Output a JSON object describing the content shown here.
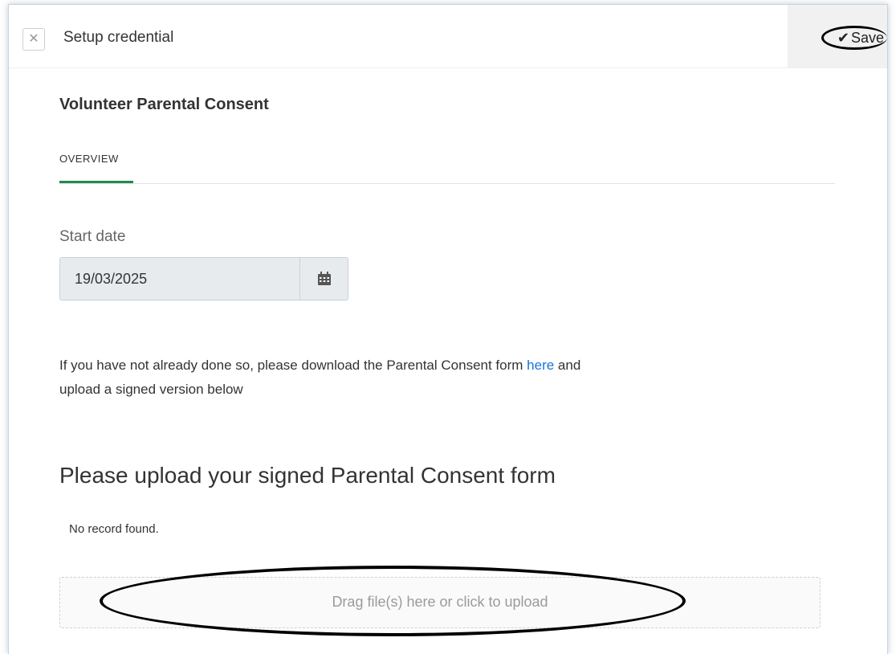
{
  "header": {
    "title": "Setup credential",
    "close_icon": "close-icon",
    "save_label": "Save",
    "save_icon": "check-icon"
  },
  "main": {
    "heading": "Volunteer Parental Consent",
    "tabs": [
      {
        "label": "OVERVIEW",
        "active": true
      }
    ],
    "start_date": {
      "label": "Start date",
      "value": "19/03/2025",
      "icon": "calendar-icon"
    },
    "info": {
      "text_before": "If you have not already done so, please download the Parental Consent form ",
      "link_text": "here",
      "text_after": " and upload a signed version below"
    },
    "upload": {
      "heading": "Please upload your signed Parental Consent form",
      "empty_text": "No record found.",
      "dropzone_text": "Drag file(s) here or click to upload"
    }
  },
  "colors": {
    "accent": "#1f8b4c",
    "link": "#1a73d9",
    "field_bg": "#e7ebee"
  }
}
